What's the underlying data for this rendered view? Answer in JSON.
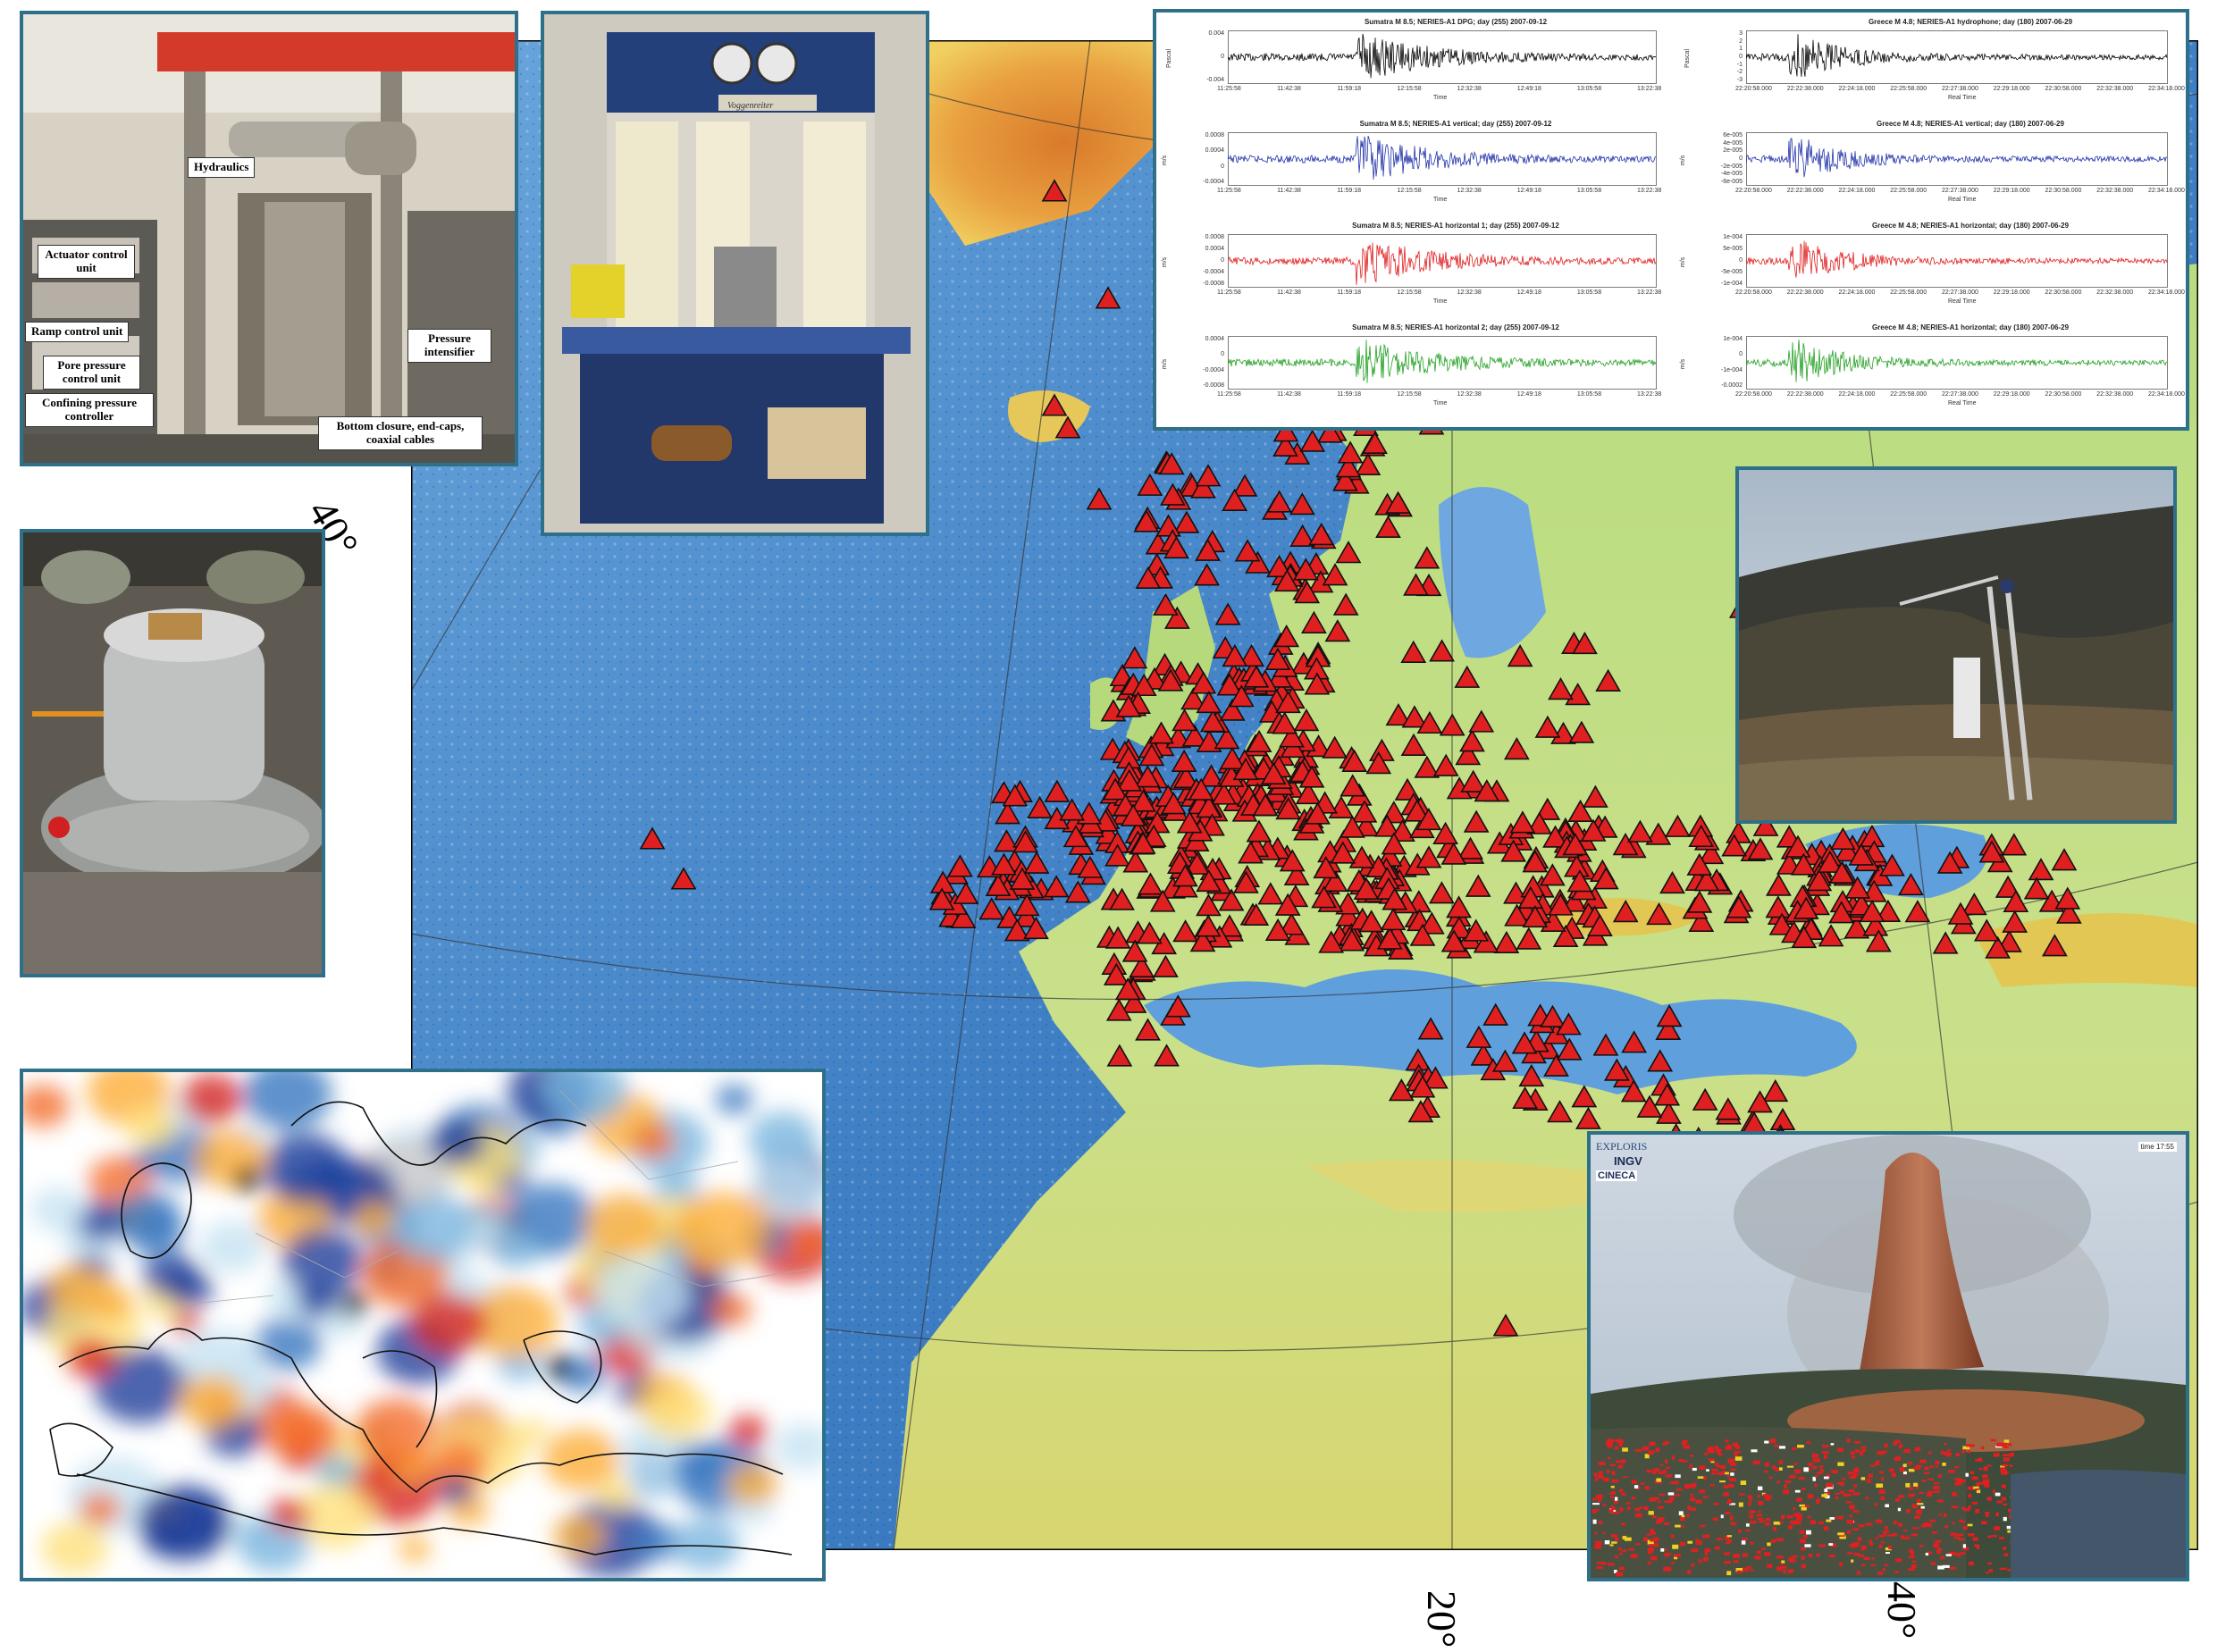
{
  "map": {
    "lat_label": "40°",
    "lon_labels": [
      "20°",
      "40°"
    ]
  },
  "rock_lab": {
    "labels": {
      "hydraulics": "Hydraulics",
      "actuator": "Actuator control unit",
      "ramp": "Ramp control unit",
      "pore": "Pore pressure control unit",
      "confining": "Confining pressure controller",
      "intensifier": "Pressure intensifier",
      "closure": "Bottom closure, end-caps, coaxial cables"
    }
  },
  "press_photo": {
    "brand": "Voggenreiter"
  },
  "seismograms": {
    "left": [
      {
        "title": "Sumatra M 8.5; NERIES-A1 DPG; day (255) 2007-09-12",
        "unit": "Pascal",
        "yticks": [
          "0.004",
          "0",
          "-0.004"
        ],
        "color": "#000000"
      },
      {
        "title": "Sumatra M 8.5; NERIES-A1 vertical; day (255) 2007-09-12",
        "unit": "m/s",
        "yticks": [
          "0.0008",
          "0.0004",
          "0",
          "-0.0004"
        ],
        "color": "#2233aa"
      },
      {
        "title": "Sumatra M 8.5; NERIES-A1 horizontal 1; day (255) 2007-09-12",
        "unit": "m/s",
        "yticks": [
          "0.0008",
          "0.0004",
          "0",
          "-0.0004",
          "-0.0008"
        ],
        "color": "#e02020"
      },
      {
        "title": "Sumatra M 8.5; NERIES-A1 horizontal 2; day (255) 2007-09-12",
        "unit": "m/s",
        "yticks": [
          "0.0004",
          "0",
          "-0.0004",
          "-0.0008"
        ],
        "color": "#22a022"
      }
    ],
    "left_xticks": [
      "11:25:58",
      "11:42:38",
      "11:59:18",
      "12:15:58",
      "12:32:38",
      "12:49:18",
      "13:05:58",
      "13:22:38"
    ],
    "left_xlabel": "Time",
    "right": [
      {
        "title": "Greece M 4.8; NERIES-A1 hydrophone; day (180) 2007-06-29",
        "unit": "Pascal",
        "yticks": [
          "3",
          "2",
          "1",
          "0",
          "-1",
          "-2",
          "-3"
        ],
        "color": "#000000"
      },
      {
        "title": "Greece M 4.8; NERIES-A1 vertical; day (180) 2007-06-29",
        "unit": "m/s",
        "yticks": [
          "6e-005",
          "4e-005",
          "2e-005",
          "0",
          "-2e-005",
          "-4e-005",
          "-6e-005"
        ],
        "color": "#2233aa"
      },
      {
        "title": "Greece M 4.8; NERIES-A1 horizontal; day (180) 2007-06-29",
        "unit": "m/s",
        "yticks": [
          "1e-004",
          "5e-005",
          "0",
          "-5e-005",
          "-1e-004"
        ],
        "color": "#e02020"
      },
      {
        "title": "Greece M 4.8; NERIES-A1 horizontal; day (180) 2007-06-29",
        "unit": "m/s",
        "yticks": [
          "1e-004",
          "0",
          "-1e-004",
          "-0.0002"
        ],
        "color": "#22a022"
      }
    ],
    "right_xticks": [
      "22:20:58.000",
      "22:22:38.000",
      "22:24:18.000",
      "22:25:58.000",
      "22:27:38.000",
      "22:29:18.000",
      "22:30:58.000",
      "22:32:38.000",
      "22:34:18.000"
    ],
    "right_xlabel": "Real Time"
  },
  "volcano": {
    "logos": {
      "explorisLogo": "EXPLORIS",
      "ingv": "INGV",
      "cineca": "CINECA"
    },
    "timestamp": "time 17:55"
  },
  "colors": {
    "panel_border": "#2e6f8a",
    "station_marker": "#e02020",
    "ocean": "#4a86c8",
    "land_low": "#9fd07a",
    "land_high": "#e8c048"
  }
}
